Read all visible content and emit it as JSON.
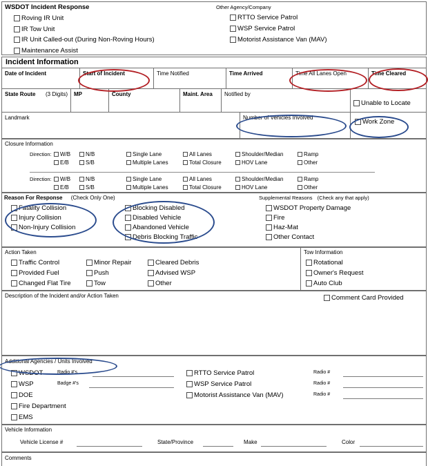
{
  "form": {
    "response_section": {
      "title": "WSDOT Incident Response",
      "other_agency_title": "Other Agency/Company",
      "wsdot_options": [
        "Roving IR Unit",
        "IR Tow Unit",
        "IR Unit Called-out (During Non-Roving Hours)",
        "Maintenance Assist"
      ],
      "other_options": [
        "RTTO Service Patrol",
        "WSP Service Patrol",
        "Motorist Assistance Van (MAV)"
      ]
    },
    "incident_information": {
      "title": "Incident Information",
      "time_row": [
        "Date of Incident",
        "Start of Incident",
        "Time Notified",
        "Time Arrived",
        "Time All Lanes Open",
        "Time Cleared"
      ],
      "route_row": [
        "State Route",
        "(3 Digits)",
        "MP",
        "County",
        "Maint. Area",
        "Notified by"
      ],
      "unable_to_locate": "Unable to Locate",
      "landmark": "Landmark",
      "number_of_vehicles": "Number of Vehicles Involved",
      "work_zone": "Work Zone"
    },
    "closure_information": {
      "title": "Closure Information",
      "direction_label": "Direction:",
      "col1": [
        "W/B",
        "E/B"
      ],
      "col2": [
        "N/B",
        "S/B"
      ],
      "col3": [
        "Single Lane",
        "Multiple Lanes"
      ],
      "col4": [
        "All Lanes",
        "Total Closure"
      ],
      "col5": [
        "Shoulder/Median",
        "HOV Lane"
      ],
      "col6": [
        "Ramp",
        "Other"
      ]
    },
    "reason_for_response": {
      "title": "Reason For Response",
      "title_note": "(Check Only One)",
      "col1": [
        "Fatality Collision",
        "Injury Collision",
        "Non-Injury Collision"
      ],
      "col2": [
        "Blocking Disabled",
        "Disabled Vehicle",
        "Abandoned Vehicle",
        "Debris Blocking Traffic"
      ],
      "supplemental_title": "Supplemental Reasons",
      "supplemental_note": "(Check any that apply)",
      "supplemental": [
        "WSDOT Property Damage",
        "Fire",
        "Haz-Mat",
        "Other Contact"
      ]
    },
    "action_taken": {
      "title": "Action Taken",
      "col1": [
        "Traffic Control",
        "Provided Fuel",
        "Changed Flat Tire"
      ],
      "col2": [
        "Minor Repair",
        "Push",
        "Tow"
      ],
      "col3": [
        "Cleared Debris",
        "Advised WSP",
        "Other"
      ],
      "tow_title": "Tow Information",
      "tow_options": [
        "Rotational",
        "Owner's Request",
        "Auto Club"
      ]
    },
    "description": {
      "title": "Description of the Incident and/or Action Taken",
      "comment_card": "Comment Card Provided"
    },
    "additional_agencies": {
      "title": "Additional Agencies / Units Involved",
      "left_options": [
        "WSDOT",
        "WSP",
        "DOE",
        "Fire Department",
        "EMS"
      ],
      "wsdot_radio_label": "Radio #'s",
      "wsp_badge_label": "Badge #'s",
      "right_options": [
        "RTTO Service Patrol",
        "WSP Service Patrol",
        "Motorist Assistance Van (MAV)"
      ],
      "radio_label": "Radio #"
    },
    "vehicle_information": {
      "title": "Vehicle Information",
      "fields": [
        "Vehicle License #",
        "State/Province",
        "Make",
        "Color"
      ]
    },
    "comments": {
      "title": "Comments"
    }
  },
  "annotations": {
    "red_color": "#b32025",
    "blue_color": "#2a4b8d",
    "red_ovals": [
      "Start of Incident",
      "Time All Lanes Open",
      "Time Cleared"
    ],
    "blue_ovals": [
      "Number of Vehicles Involved",
      "Work Zone",
      "Fatality/Injury/Non-Injury Collision",
      "Blocking Disabled/Disabled Vehicle/Abandoned Vehicle/Debris Blocking Traffic",
      "Additional Agencies / Units Involved"
    ]
  }
}
